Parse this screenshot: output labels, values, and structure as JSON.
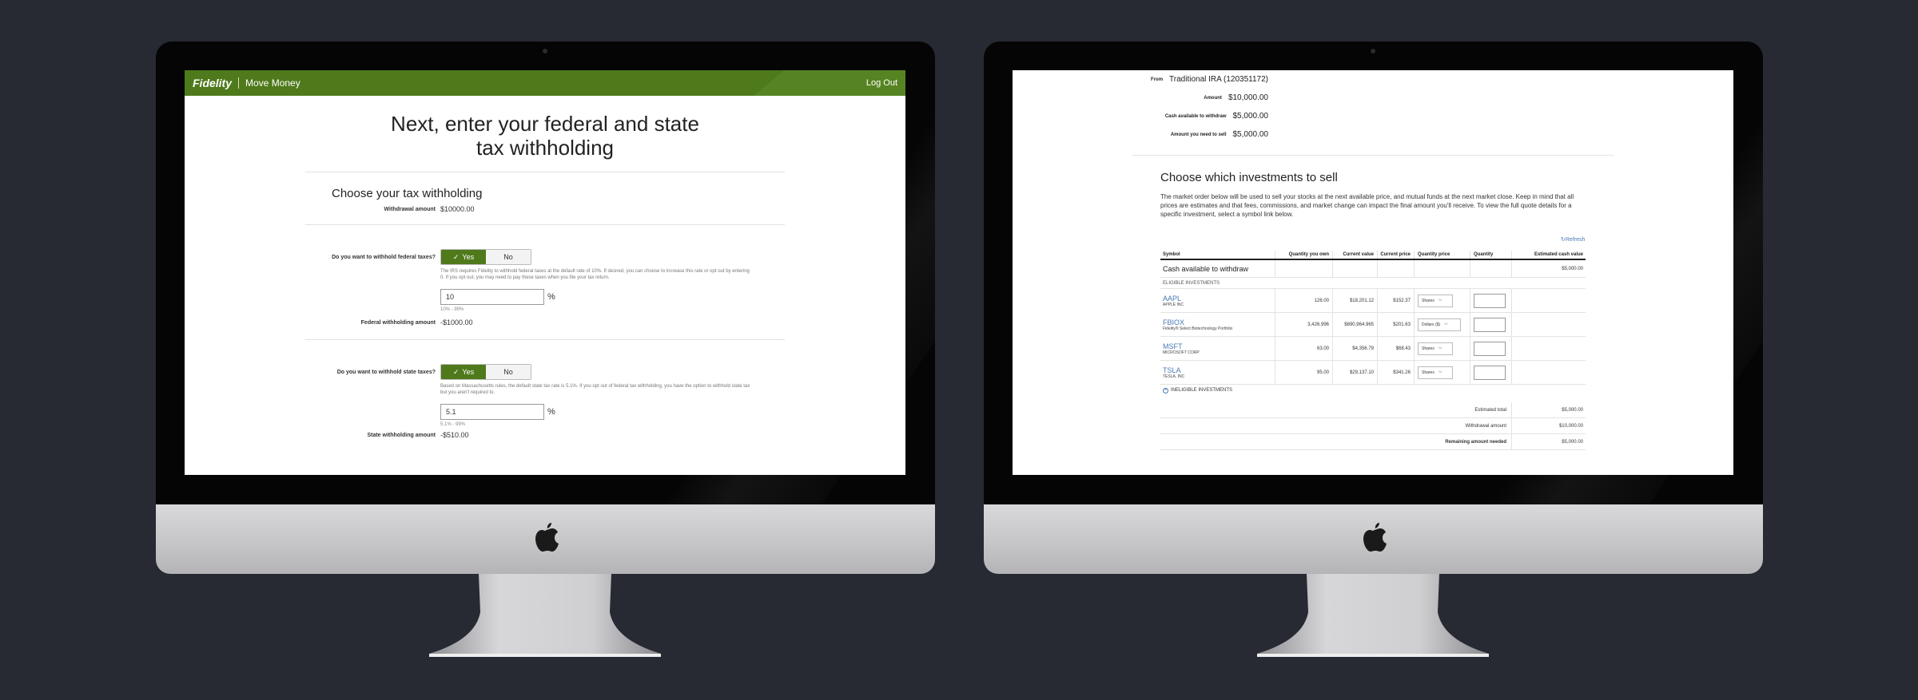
{
  "left_screen": {
    "header": {
      "brand": "Fidelity",
      "section": "Move Money",
      "logout": "Log Out",
      "color": "#4e7a1b"
    },
    "title": "Next, enter your federal and state tax withholding",
    "choose_title": "Choose your tax withholding",
    "withdrawal_label": "Withdrawal amount",
    "withdrawal_value": "$10000.00",
    "federal": {
      "question": "Do you want to withhold federal taxes?",
      "yes": "Yes",
      "no": "No",
      "note": "The IRS requires Fidelity to withhold federal taxes at the default rate of 10%. If desired, you can choose to increase this rate or opt out by entering 0. If you opt out, you may need to pay these taxes when you file your tax return.",
      "rate_value": "10",
      "pct": "%",
      "range": "10% - 99%",
      "amount_label": "Federal withholding amount",
      "amount_value": "-$1000.00"
    },
    "state": {
      "question": "Do you want to withhold state taxes?",
      "yes": "Yes",
      "no": "No",
      "note": "Based on Massachusetts rules, the default state tax rate is 5.1%. If you opt out of federal tax withholding, you have the option to withhold state tax but you aren't required to.",
      "rate_value": "5.1",
      "pct": "%",
      "range": "5.1% - 99%",
      "amount_label": "State withholding amount",
      "amount_value": "-$510.00"
    }
  },
  "right_screen": {
    "summary": [
      {
        "label": "From",
        "value": "Traditional IRA (120351172)"
      },
      {
        "label": "Amount",
        "value": "$10,000.00"
      },
      {
        "label": "Cash available to withdraw",
        "value": "$5,000.00"
      },
      {
        "label": "Amount you need to sell",
        "value": "$5,000.00"
      }
    ],
    "title": "Choose which investments to sell",
    "description": "The market order below will be used to sell your stocks at the next available price, and mutual funds at the next market close. Keep in mind that all prices are estimates and that fees, commissions, and market change can impact the final amount you'll receive. To view the full quote details for a specific investment, select a symbol link below.",
    "refresh": "Refresh",
    "columns": [
      "Symbol",
      "Quantity you own",
      "Current value",
      "Current price",
      "Quantity price",
      "Quantity",
      "Estimated cash value"
    ],
    "cash_row": {
      "label": "Cash available to withdraw",
      "value": "$5,000.00"
    },
    "eligible_label": "ELIGIBLE INVESTMENTS",
    "rows": [
      {
        "ticker": "AAPL",
        "name": "APPLE INC",
        "qty": "126.00",
        "value": "$18,201.12",
        "price": "$152.37",
        "unit": "Shares"
      },
      {
        "ticker": "FBIOX",
        "name": "Fidelity® Select Biotechnology Portfolio",
        "qty": "3,426.996",
        "value": "$690,964.965",
        "price": "$201.63",
        "unit": "Dollars ($)"
      },
      {
        "ticker": "MSFT",
        "name": "MICROSOFT CORP",
        "qty": "63.00",
        "value": "$4,356.79",
        "price": "$68.43",
        "unit": "Shares"
      },
      {
        "ticker": "TSLA",
        "name": "TESLA, INC",
        "qty": "95.00",
        "value": "$29,137.10",
        "price": "$341.26",
        "unit": "Shares"
      }
    ],
    "ineligible_label": "INELIGIBLE INVESTMENTS",
    "totals": [
      {
        "label": "Estimated total",
        "value": "$5,000.00"
      },
      {
        "label": "Withdrawal amount",
        "value": "$10,000.00"
      },
      {
        "label": "Remaining amount needed",
        "value": "$5,000.00"
      }
    ]
  }
}
